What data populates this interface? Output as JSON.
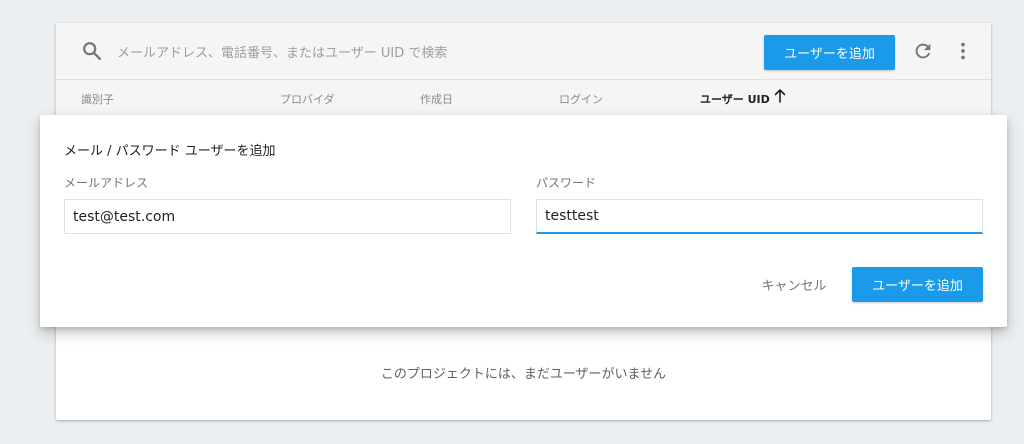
{
  "search": {
    "placeholder": "メールアドレス、電話番号、またはユーザー UID で検索"
  },
  "toolbar": {
    "add_user_label": "ユーザーを追加",
    "icons": [
      "search-icon",
      "refresh-icon",
      "more-vert-icon"
    ]
  },
  "table": {
    "columns": [
      {
        "label": "識別子",
        "sorted": false
      },
      {
        "label": "プロバイダ",
        "sorted": false
      },
      {
        "label": "作成日",
        "sorted": false
      },
      {
        "label": "ログイン",
        "sorted": false
      },
      {
        "label": "ユーザー UID",
        "sorted": true,
        "sort_direction": "ascending"
      }
    ],
    "empty_message": "このプロジェクトには、まだユーザーがいません"
  },
  "dialog": {
    "title": "メール / パスワード ユーザーを追加",
    "email": {
      "label": "メールアドレス",
      "value": "test@test.com"
    },
    "password": {
      "label": "パスワード",
      "value": "testtest"
    },
    "cancel_label": "キャンセル",
    "submit_label": "ユーザーを追加"
  },
  "colors": {
    "accent": "#1a9ae8",
    "background": "#eceff1",
    "toolbar": "#f5f5f5"
  }
}
